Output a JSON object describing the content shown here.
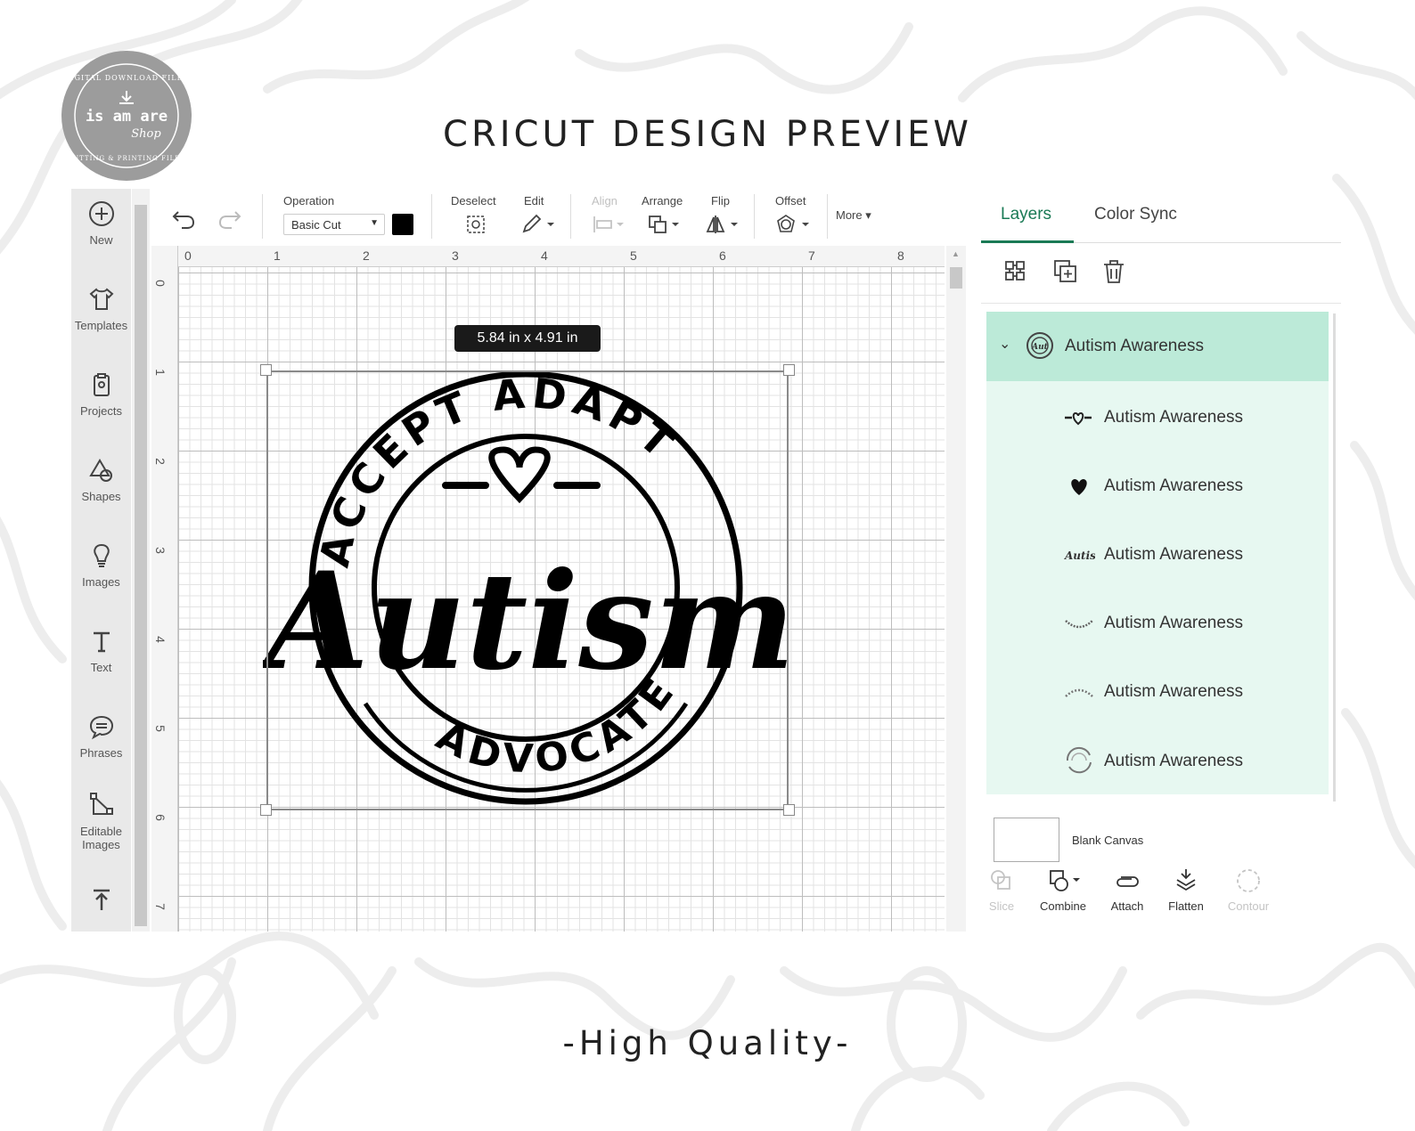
{
  "page": {
    "title": "CRICUT DESIGN PREVIEW",
    "footer": "-High Quality-"
  },
  "logo": {
    "ring_text_top": "DIGITAL DOWNLOAD FILES",
    "ring_text_bottom": "CUTTING & PRINTING FILES",
    "name": "is am are",
    "script": "Shop"
  },
  "sidebar": {
    "items": [
      {
        "label": "New",
        "icon": "plus-circle-icon"
      },
      {
        "label": "Templates",
        "icon": "shirt-icon"
      },
      {
        "label": "Projects",
        "icon": "clipboard-icon"
      },
      {
        "label": "Shapes",
        "icon": "shapes-icon"
      },
      {
        "label": "Images",
        "icon": "lightbulb-icon"
      },
      {
        "label": "Text",
        "icon": "text-icon"
      },
      {
        "label": "Phrases",
        "icon": "speech-bubble-icon"
      },
      {
        "label": "Editable Images",
        "icon": "editable-images-icon"
      }
    ]
  },
  "toolbar": {
    "operation_label": "Operation",
    "operation_value": "Basic Cut",
    "operation_color": "#000000",
    "deselect_label": "Deselect",
    "edit_label": "Edit",
    "align_label": "Align",
    "arrange_label": "Arrange",
    "flip_label": "Flip",
    "offset_label": "Offset",
    "more_label": "More"
  },
  "canvas": {
    "ruler_top": [
      "0",
      "1",
      "2",
      "3",
      "4",
      "5",
      "6",
      "7",
      "8"
    ],
    "ruler_left": [
      "0",
      "1",
      "2",
      "3",
      "4",
      "5",
      "6",
      "7"
    ],
    "size_tooltip": "5.84  in x 4.91  in",
    "design": {
      "arc_top": "ACCEPT ADAPT",
      "arc_bottom": "ADVOCATE",
      "main_word": "Autism"
    }
  },
  "panel": {
    "tabs": [
      "Layers",
      "Color Sync"
    ],
    "active_tab": "Layers",
    "accent_color": "#1a7a55",
    "group": {
      "name": "Autism Awareness",
      "expanded": true
    },
    "layers": [
      {
        "name": "Autism Awareness",
        "thumb": "heart-dash-thumb"
      },
      {
        "name": "Autism Awareness",
        "thumb": "heart-thumb"
      },
      {
        "name": "Autism Awareness",
        "thumb": "script-thumb"
      },
      {
        "name": "Autism Awareness",
        "thumb": "advocate-arc-thumb"
      },
      {
        "name": "Autism Awareness",
        "thumb": "accept-arc-thumb"
      },
      {
        "name": "Autism Awareness",
        "thumb": "circle-rings-thumb"
      }
    ],
    "blank_canvas_label": "Blank Canvas",
    "actions": [
      {
        "label": "Slice",
        "enabled": false
      },
      {
        "label": "Combine",
        "enabled": true
      },
      {
        "label": "Attach",
        "enabled": true
      },
      {
        "label": "Flatten",
        "enabled": true
      },
      {
        "label": "Contour",
        "enabled": false
      }
    ]
  }
}
